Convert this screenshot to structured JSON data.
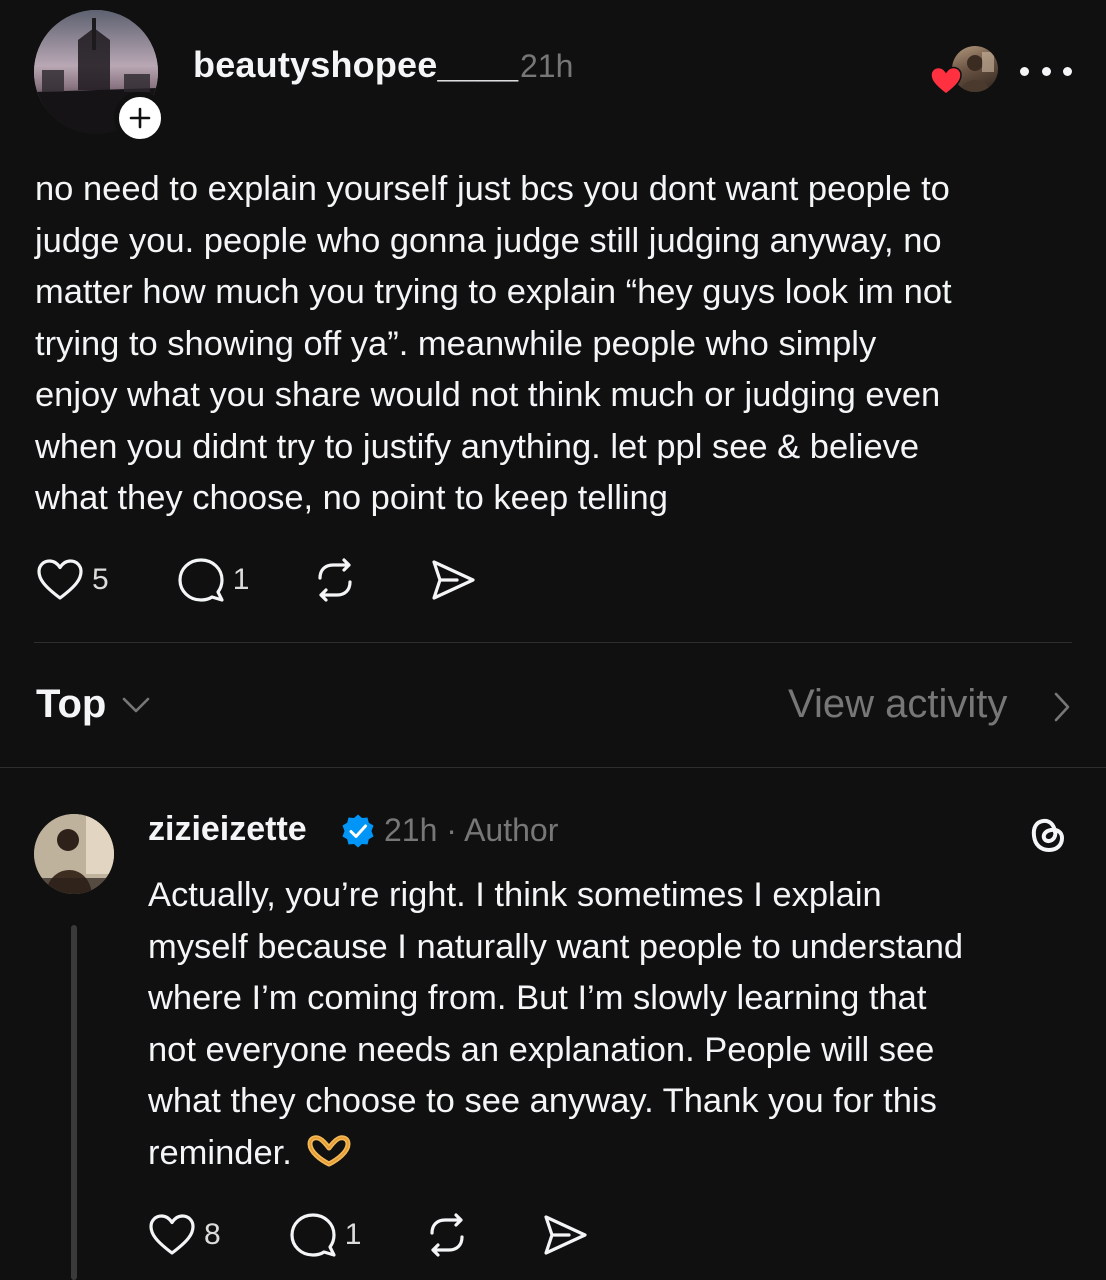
{
  "post": {
    "username": "beautyshopee____",
    "time": "21h",
    "body": "no need to explain yourself just bcs you dont want people to\njudge you. people who gonna judge still judging anyway, no\nmatter how much you trying to explain “hey guys look im not\ntrying to showing off ya”. meanwhile people who simply\nenjoy what you share would not think much or judging even\nwhen you didnt try to justify anything. let ppl see & believe\nwhat they choose, no point to keep telling",
    "likes": "5",
    "replies": "1",
    "icons": [
      "heart-icon",
      "comment-icon",
      "repost-icon",
      "share-icon",
      "more-icon",
      "plus-icon"
    ]
  },
  "sort": {
    "label": "Top",
    "view_activity": "View activity"
  },
  "reply": {
    "username": "zizieizette",
    "time": "21h",
    "separator": "·",
    "author_tag": "Author",
    "body": "Actually, you’re right. I think sometimes I explain\nmyself because I naturally want people to understand\nwhere I’m coming from. But I’m slowly learning that\nnot everyone needs an explanation. People will see\nwhat they choose to see anyway. Thank you for this\nreminder.",
    "likes": "8",
    "replies": "1",
    "icons": [
      "verified-icon",
      "threads-logo-icon",
      "heart-hands-icon"
    ]
  },
  "colors": {
    "background": "#101010",
    "text": "#f3f5f7",
    "muted": "#777777",
    "verified": "#0095f6",
    "like_heart": "#ff3040"
  }
}
